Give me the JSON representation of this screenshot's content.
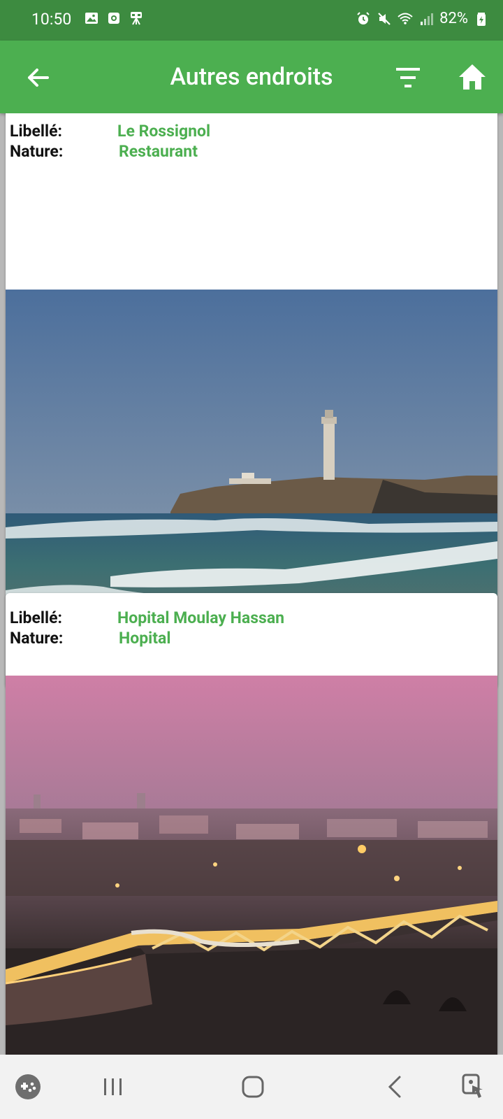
{
  "status_bar": {
    "time": "10:50",
    "battery": "82%",
    "left_icons": [
      "image-icon",
      "camera-notification-icon",
      "app-notification-icon"
    ],
    "right_icons": [
      "alarm-icon",
      "mute-icon",
      "wifi-icon",
      "signal-icon",
      "battery-charging-icon"
    ]
  },
  "app_bar": {
    "title": "Autres endroits",
    "background_color": "#4caf50",
    "icons": [
      "back-arrow-icon",
      "filter-icon",
      "home-icon"
    ]
  },
  "places": [
    {
      "label_key": "Libellé:",
      "label_value": "Le Rossignol",
      "nature_key": "Nature:",
      "nature_value": "Restaurant",
      "image": "lighthouse-beach-photo"
    },
    {
      "label_key": "Libellé:",
      "label_value": "Hopital Moulay Hassan",
      "nature_key": "Nature:",
      "nature_value": "Hopital",
      "image": "city-bridge-night-photo"
    }
  ],
  "nav_bar": {
    "icons": [
      "game-launcher-icon",
      "recent-apps-icon",
      "home-nav-icon",
      "back-nav-icon",
      "accessibility-icon"
    ]
  },
  "colors": {
    "accent": "#4caf50",
    "status_bar": "#3d8b40"
  }
}
